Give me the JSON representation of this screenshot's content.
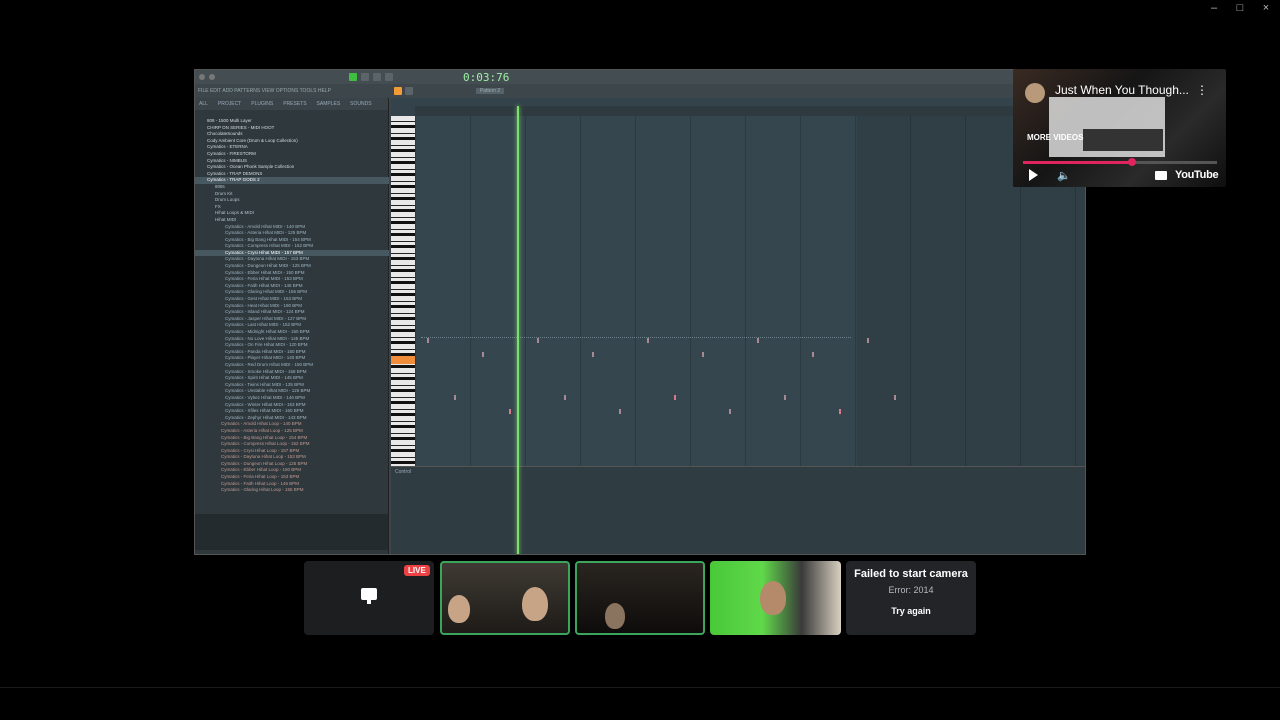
{
  "window": {
    "minimize": "–",
    "maximize": "□",
    "close": "×"
  },
  "fl": {
    "time_display": "0:03:76",
    "menu": "FILE EDIT ADD PATTERNS VIEW OPTIONS TOOLS HELP",
    "pattern_label": "Pattern 2",
    "browser_tabs": [
      "ALL",
      "PROJECT",
      "PLUGINS",
      "PRESETS",
      "SAMPLES",
      "SOUNDS"
    ],
    "browser_items": [
      {
        "label": "808 - 1500 Multi Layer",
        "kind": "folder"
      },
      {
        "label": "CHIRP ON SERIES - MIDI HOOT",
        "kind": "folder"
      },
      {
        "label": "ChocolateSounds",
        "kind": "folder"
      },
      {
        "label": "Cody Ambient Core (Drum & Loop Collection)",
        "kind": "folder"
      },
      {
        "label": "Cymatics - ETERNA",
        "kind": "folder"
      },
      {
        "label": "Cymatics - FIRESTORM",
        "kind": "folder"
      },
      {
        "label": "Cymatics - NIMBUS",
        "kind": "folder"
      },
      {
        "label": "Cymatics - Ocean Phonk Sample Collection",
        "kind": "folder"
      },
      {
        "label": "Cymatics - TRAP DEMONS",
        "kind": "folder"
      },
      {
        "label": "Cymatics - TRAP GODS 2",
        "kind": "folder-sel"
      },
      {
        "label": "808s",
        "kind": "l2"
      },
      {
        "label": "Drum Kit",
        "kind": "l2"
      },
      {
        "label": "Drum Loops",
        "kind": "l2"
      },
      {
        "label": "FX",
        "kind": "l2"
      },
      {
        "label": "Hihat Loops & MIDI",
        "kind": "l2"
      },
      {
        "label": "Hihat MIDI",
        "kind": "l2"
      },
      {
        "label": "Cymatics - Amold Hihat MIDI - 140 BPM",
        "kind": "l3"
      },
      {
        "label": "Cymatics - Asteria Hihat MIDI - 125 BPM",
        "kind": "l3"
      },
      {
        "label": "Cymatics - Big Bang Hihat MIDI - 154 BPM",
        "kind": "l3"
      },
      {
        "label": "Cymatics - Compress Hihat MIDI - 152 BPM",
        "kind": "l3"
      },
      {
        "label": "Cymatics - Crysi Hihat MIDI - 157 BPM",
        "kind": "sel"
      },
      {
        "label": "Cymatics - Daytona Hihat MIDI - 153 BPM",
        "kind": "l3"
      },
      {
        "label": "Cymatics - Dungeon Hihat MIDI - 125 BPM",
        "kind": "l3"
      },
      {
        "label": "Cymatics - Ebber Hihat MIDI - 150 BPM",
        "kind": "l3"
      },
      {
        "label": "Cymatics - Feria Hihat MIDI - 153 BPM",
        "kind": "l3"
      },
      {
        "label": "Cymatics - Faith Hihat MIDI - 146 BPM",
        "kind": "l3"
      },
      {
        "label": "Cymatics - Glaring Hihat MIDI - 155 BPM",
        "kind": "l3"
      },
      {
        "label": "Cymatics - Gest Hihat MIDI - 153 BPM",
        "kind": "l3"
      },
      {
        "label": "Cymatics - Heat Hihat MIDI - 190 BPM",
        "kind": "l3"
      },
      {
        "label": "Cymatics - Island Hihat MIDI - 124 BPM",
        "kind": "l3"
      },
      {
        "label": "Cymatics - Jasper Hihat MIDI - 127 BPM",
        "kind": "l3"
      },
      {
        "label": "Cymatics - Last Hihat MIDI - 152 BPM",
        "kind": "l3"
      },
      {
        "label": "Cymatics - Midnight Hihat MIDI - 150 BPM",
        "kind": "l3"
      },
      {
        "label": "Cymatics - No Love Hihat MIDI - 145 BPM",
        "kind": "l3"
      },
      {
        "label": "Cymatics - On Fire Hihat MIDI - 120 BPM",
        "kind": "l3"
      },
      {
        "label": "Cymatics - Panda Hihat MIDI - 150 BPM",
        "kind": "l3"
      },
      {
        "label": "Cymatics - Player Hihat MIDI - 140 BPM",
        "kind": "l3"
      },
      {
        "label": "Cymatics - Red Drum Hihat MIDI - 150 BPM",
        "kind": "l3"
      },
      {
        "label": "Cymatics - Smoke Hihat MIDI - 158 BPM",
        "kind": "l3"
      },
      {
        "label": "Cymatics - Spirit Hihat MIDI - 145 BPM",
        "kind": "l3"
      },
      {
        "label": "Cymatics - Twins Hihat MIDI - 135 BPM",
        "kind": "l3"
      },
      {
        "label": "Cymatics - Unstable Hihat MIDI - 126 BPM",
        "kind": "l3"
      },
      {
        "label": "Cymatics - Vybez Hihat MIDI - 146 BPM",
        "kind": "l3"
      },
      {
        "label": "Cymatics - Winter Hihat MIDI - 153 BPM",
        "kind": "l3"
      },
      {
        "label": "Cymatics - Xfiles Hihat MIDI - 160 BPM",
        "kind": "l3"
      },
      {
        "label": "Cymatics - Zephyr Hihat MIDI - 143 BPM",
        "kind": "l3"
      },
      {
        "label": "Cymatics - Amold Hihat Loop - 140 BPM",
        "kind": "loop"
      },
      {
        "label": "Cymatics - Asteria Hihat Loop - 125 BPM",
        "kind": "loop"
      },
      {
        "label": "Cymatics - Big Bang Hihat Loop - 154 BPM",
        "kind": "loop"
      },
      {
        "label": "Cymatics - Compress Hihat Loop - 152 BPM",
        "kind": "loop"
      },
      {
        "label": "Cymatics - Crysi Hihat Loop - 157 BPM",
        "kind": "loop"
      },
      {
        "label": "Cymatics - Daytona Hihat Loop - 153 BPM",
        "kind": "loop"
      },
      {
        "label": "Cymatics - Dungeon Hihat Loop - 125 BPM",
        "kind": "loop"
      },
      {
        "label": "Cymatics - Ebber Hihat Loop - 150 BPM",
        "kind": "loop"
      },
      {
        "label": "Cymatics - Feria Hihat Loop - 153 BPM",
        "kind": "loop"
      },
      {
        "label": "Cymatics - Faith Hihat Loop - 146 BPM",
        "kind": "loop"
      },
      {
        "label": "Cymatics - Glaring Hihat Loop - 155 BPM",
        "kind": "loop"
      }
    ],
    "control_label": "Control"
  },
  "youtube": {
    "title": "Just When You Though...",
    "more_videos": "MORE VIDEOS",
    "logo": "YouTube",
    "progress_fraction": 0.56
  },
  "call": {
    "live_badge": "LIVE",
    "error_title": "Failed to start camera",
    "error_code": "Error: 2014",
    "retry_label": "Try again"
  }
}
